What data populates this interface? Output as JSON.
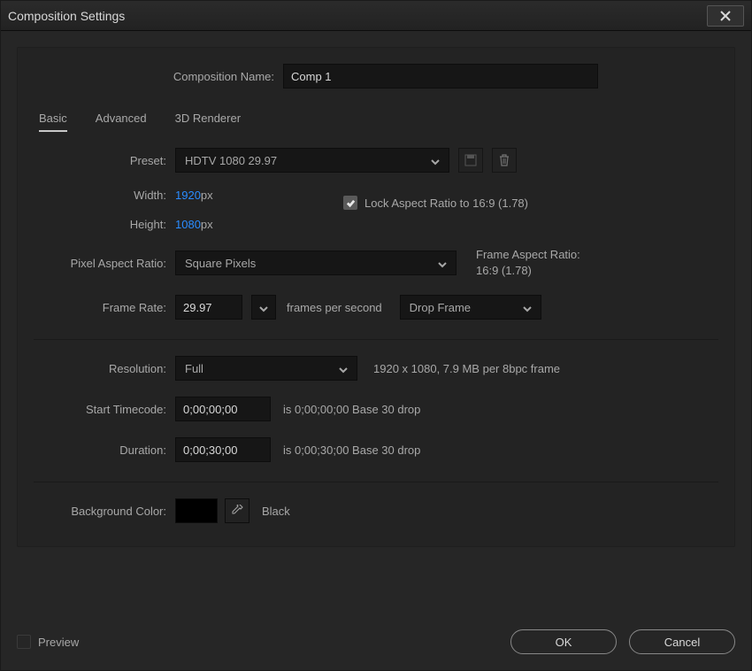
{
  "window": {
    "title": "Composition Settings"
  },
  "compName": {
    "label": "Composition Name:",
    "value": "Comp 1"
  },
  "tabs": {
    "basic": "Basic",
    "advanced": "Advanced",
    "renderer": "3D Renderer"
  },
  "preset": {
    "label": "Preset:",
    "value": "HDTV 1080 29.97"
  },
  "width": {
    "label": "Width:",
    "value": "1920",
    "unit": " px"
  },
  "height": {
    "label": "Height:",
    "value": "1080",
    "unit": " px"
  },
  "lockAspect": {
    "label": "Lock Aspect Ratio to 16:9 (1.78)"
  },
  "par": {
    "label": "Pixel Aspect Ratio:",
    "value": "Square Pixels",
    "infoTitle": "Frame Aspect Ratio:",
    "infoValue": "16:9 (1.78)"
  },
  "frameRate": {
    "label": "Frame Rate:",
    "value": "29.97",
    "unitLabel": "frames per second",
    "dropFrame": "Drop Frame"
  },
  "resolution": {
    "label": "Resolution:",
    "value": "Full",
    "info": "1920 x 1080, 7.9 MB per 8bpc frame"
  },
  "startTC": {
    "label": "Start Timecode:",
    "value": "0;00;00;00",
    "info": "is 0;00;00;00 Base 30  drop"
  },
  "duration": {
    "label": "Duration:",
    "value": "0;00;30;00",
    "info": "is 0;00;30;00 Base 30  drop"
  },
  "bg": {
    "label": "Background Color:",
    "name": "Black",
    "swatch": "#000000"
  },
  "footer": {
    "preview": "Preview",
    "ok": "OK",
    "cancel": "Cancel"
  }
}
